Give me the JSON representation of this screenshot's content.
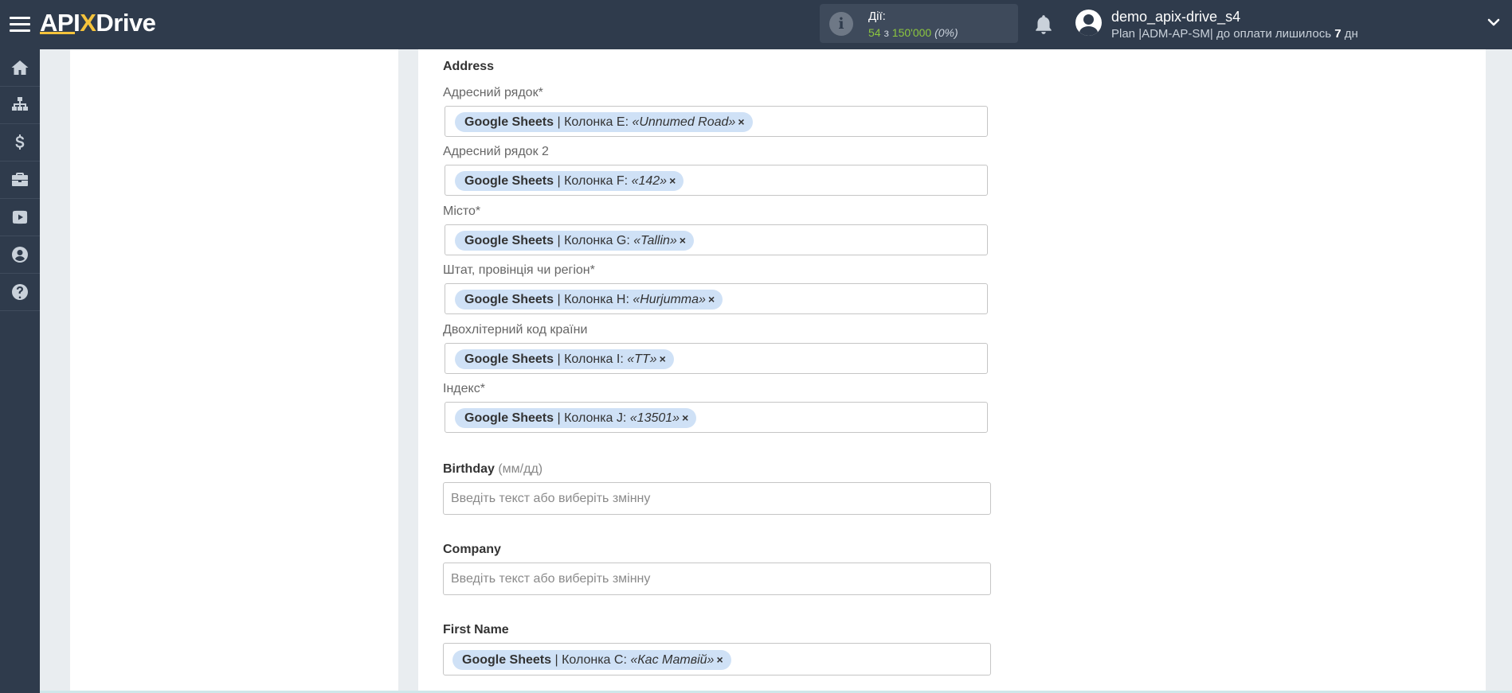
{
  "header": {
    "logo": "APIXDrive",
    "actions_label": "Дії:",
    "actions_used": "54",
    "actions_of": " з ",
    "actions_total": "150'000",
    "actions_percent": "(0%)",
    "user_name": "demo_apix-drive_s4",
    "plan_prefix": "Plan |ADM-AP-SM| до оплати лишилось ",
    "plan_days": "7",
    "plan_suffix": " дн"
  },
  "sidebar": {
    "items": [
      "home-icon",
      "sitemap-icon",
      "dollar-icon",
      "briefcase-icon",
      "youtube-icon",
      "user-icon",
      "help-icon"
    ]
  },
  "address": {
    "title": "Address",
    "fields": [
      {
        "label": "Адресний рядок*",
        "source": "Google Sheets",
        "column": " | Колонка E: ",
        "value": "«Unnumed Road»"
      },
      {
        "label": "Адресний рядок 2",
        "source": "Google Sheets",
        "column": " | Колонка F: ",
        "value": "«142»"
      },
      {
        "label": "Місто*",
        "source": "Google Sheets",
        "column": " | Колонка G: ",
        "value": "«Tallin»"
      },
      {
        "label": "Штат, провінція чи регіон*",
        "source": "Google Sheets",
        "column": " | Колонка H: ",
        "value": "«Hurjumma»"
      },
      {
        "label": "Двохлітерний код країни",
        "source": "Google Sheets",
        "column": " | Колонка I: ",
        "value": "«TT»"
      },
      {
        "label": "Індекс*",
        "source": "Google Sheets",
        "column": " | Колонка J: ",
        "value": "«13501»"
      }
    ]
  },
  "birthday": {
    "title": "Birthday",
    "hint": " (мм/дд)",
    "placeholder": "Введіть текст або виберіть змінну"
  },
  "company": {
    "title": "Company",
    "placeholder": "Введіть текст або виберіть змінну"
  },
  "first_name": {
    "title": "First Name",
    "source": "Google Sheets",
    "column": " | Колонка C: ",
    "value": "«Кас Матвій»"
  },
  "tag_remove": "×"
}
